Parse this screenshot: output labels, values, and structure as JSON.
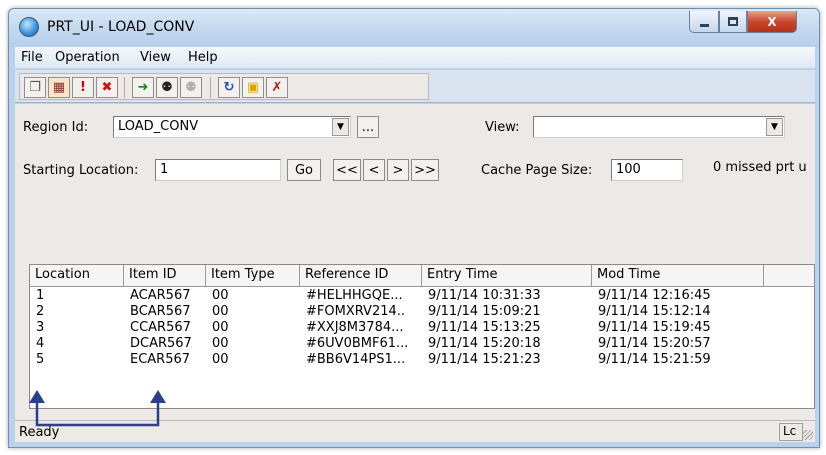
{
  "window": {
    "title": "PRT_UI - LOAD_CONV",
    "controls": {
      "minimize_icon": "minimize-icon",
      "maximize_icon": "maximize-icon",
      "close_glyph": "X"
    }
  },
  "menu": {
    "items": [
      "File",
      "Operation",
      "View",
      "Help"
    ]
  },
  "toolbar": {
    "buttons": [
      {
        "icon": "new-document-icon",
        "glyph": "❐"
      },
      {
        "icon": "calendar-icon",
        "glyph": "▦"
      },
      {
        "icon": "alert-document-icon",
        "glyph": "!"
      },
      {
        "icon": "delete-icon",
        "glyph": "✖"
      },
      {
        "icon": "go-arrow-icon",
        "glyph": "➜"
      },
      {
        "icon": "binoculars-icon",
        "glyph": "⚉"
      },
      {
        "icon": "disabled-find-icon",
        "glyph": "⚉"
      },
      {
        "icon": "refresh-icon",
        "glyph": "↻"
      },
      {
        "icon": "lock-icon",
        "glyph": "▣"
      },
      {
        "icon": "exit-icon",
        "glyph": "✗"
      }
    ]
  },
  "filters": {
    "region_label": "Region Id:",
    "region_value": "LOAD_CONV",
    "ellipsis": "...",
    "view_label": "View:",
    "view_value": "",
    "start_label": "Starting Location:",
    "start_value": "1",
    "go_label": "Go",
    "nav": {
      "first": "<<",
      "prev": "<",
      "next": ">",
      "last": ">>"
    },
    "cache_label": "Cache Page Size:",
    "cache_value": "100",
    "missed_text": "0 missed prt u"
  },
  "table": {
    "columns": [
      "Location",
      "Item ID",
      "Item Type",
      "Reference ID",
      "Entry Time",
      "Mod Time"
    ],
    "rows": [
      [
        "1",
        "ACAR567",
        "00",
        "#HELHHGQE...",
        "9/11/14 10:31:33",
        "9/11/14 12:16:45"
      ],
      [
        "2",
        "BCAR567",
        "00",
        "#FOMXRV214..",
        "9/11/14 15:09:21",
        "9/11/14 15:12:14"
      ],
      [
        "3",
        "CCAR567",
        "00",
        "#XXJ8M3784...",
        "9/11/14 15:13:25",
        "9/11/14 15:19:45"
      ],
      [
        "4",
        "DCAR567",
        "00",
        "#6UV0BMF61...",
        "9/11/14 15:20:18",
        "9/11/14 15:20:57"
      ],
      [
        "5",
        "ECAR567",
        "00",
        "#BB6V14PS1...",
        "9/11/14 15:21:23",
        "9/11/14 15:21:59"
      ]
    ]
  },
  "status": {
    "text": "Ready",
    "panel": "Lc"
  },
  "annotation": {
    "color": "#2b3f8f"
  }
}
